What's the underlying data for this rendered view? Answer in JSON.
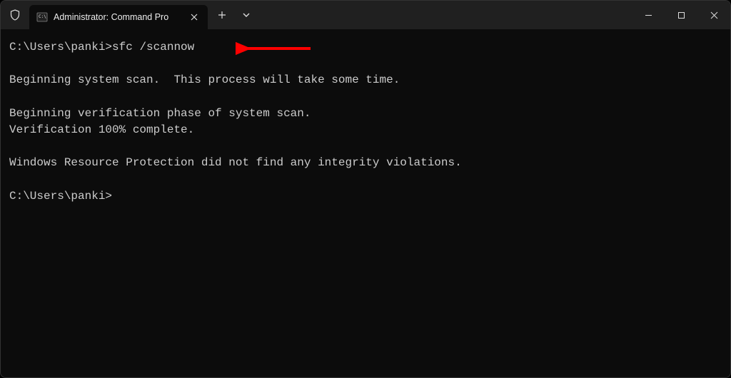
{
  "window": {
    "tab_title": "Administrator: Command Pro"
  },
  "terminal": {
    "lines": [
      {
        "prompt": "C:\\Users\\panki>",
        "cmd": "sfc /scannow"
      },
      {
        "text": ""
      },
      {
        "text": "Beginning system scan.  This process will take some time."
      },
      {
        "text": ""
      },
      {
        "text": "Beginning verification phase of system scan."
      },
      {
        "text": "Verification 100% complete."
      },
      {
        "text": ""
      },
      {
        "text": "Windows Resource Protection did not find any integrity violations."
      },
      {
        "text": ""
      },
      {
        "prompt": "C:\\Users\\panki>",
        "cmd": ""
      }
    ]
  },
  "annotation": {
    "arrow_color": "#ff0000"
  }
}
